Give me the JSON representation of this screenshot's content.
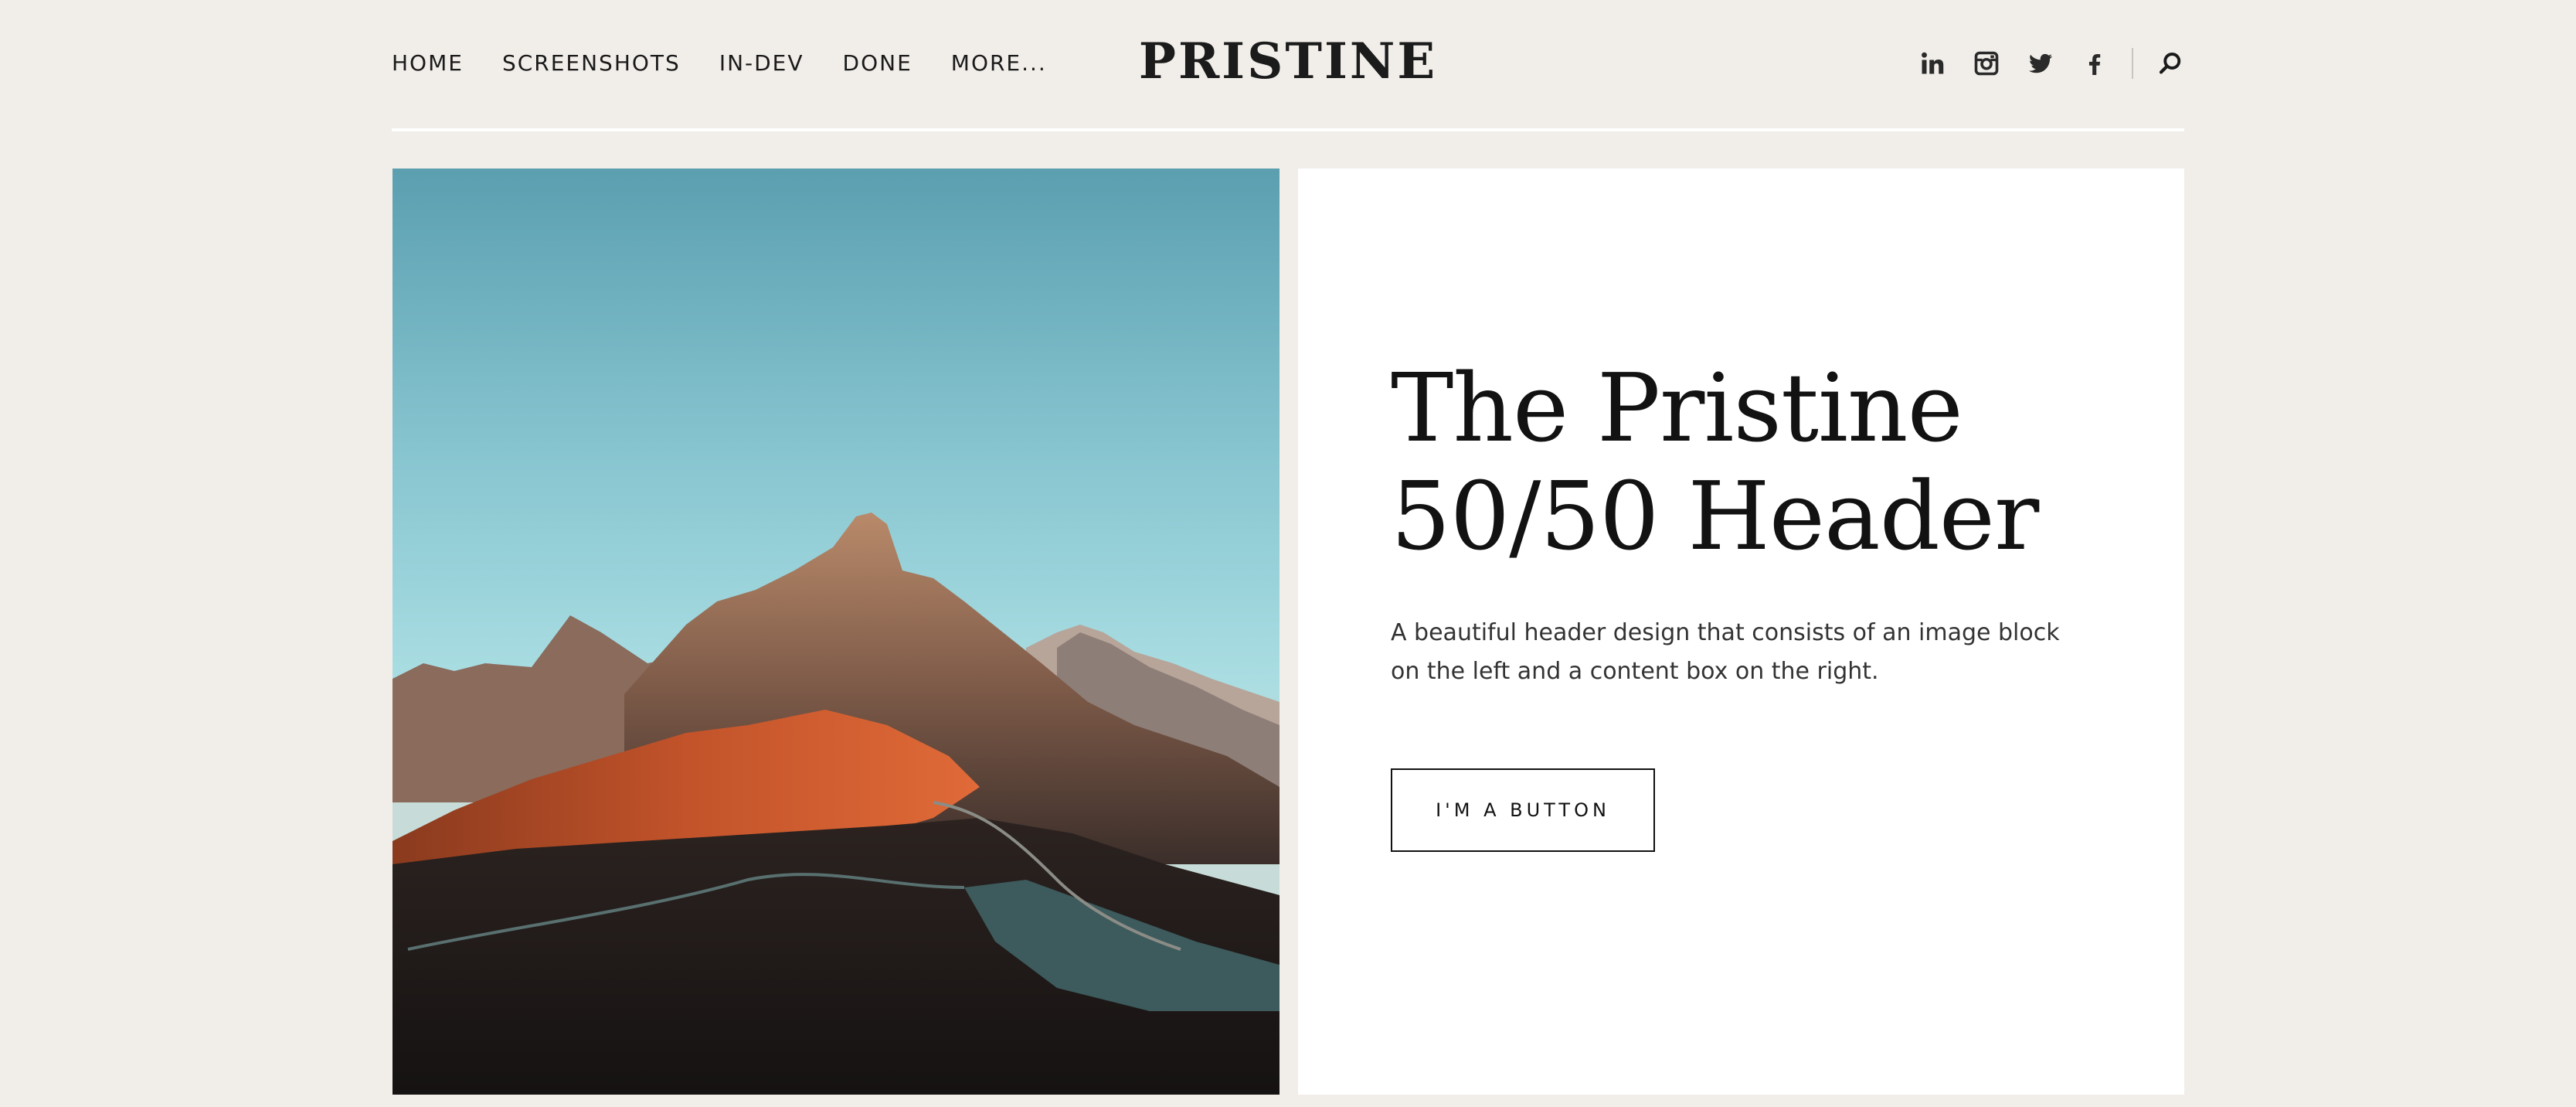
{
  "nav": {
    "items": [
      {
        "label": "HOME"
      },
      {
        "label": "SCREENSHOTS"
      },
      {
        "label": "IN-DEV"
      },
      {
        "label": "DONE"
      },
      {
        "label": "MORE..."
      }
    ]
  },
  "brand": {
    "logo": "PRISTINE"
  },
  "social": {
    "icons": [
      "linkedin-icon",
      "instagram-icon",
      "twitter-icon",
      "facebook-icon",
      "search-icon"
    ]
  },
  "hero": {
    "title_line1": "The Pristine",
    "title_line2": "50/50 Header",
    "description": "A beautiful header design that consists of an image block on the left and a content box on the right.",
    "button_label": "I'M A BUTTON"
  },
  "colors": {
    "page_background": "#f1eeea",
    "content_background": "#ffffff",
    "text": "#111111"
  }
}
